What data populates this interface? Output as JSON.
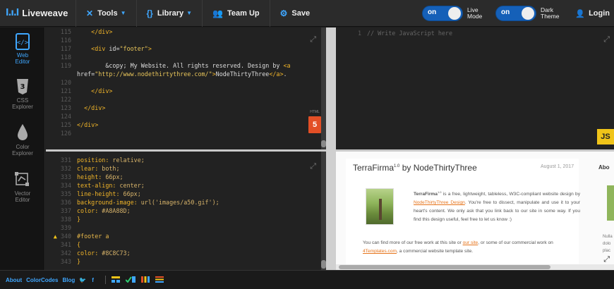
{
  "topbar": {
    "brand_logo": "l.ı.l",
    "brand_name": "Liveweave",
    "tools_label": "Tools",
    "library_label": "Library",
    "teamup_label": "Team Up",
    "save_label": "Save",
    "live_mode": {
      "state": "on",
      "label_line1": "Live",
      "label_line2": "Mode"
    },
    "dark_theme": {
      "state": "on",
      "label_line1": "Dark",
      "label_line2": "Theme"
    },
    "login_label": "Login"
  },
  "sidebar": {
    "web_editor": {
      "line1": "Web",
      "line2": "Editor"
    },
    "css_explorer": {
      "line1": "CSS",
      "line2": "Explorer"
    },
    "color_explorer": {
      "line1": "Color",
      "line2": "Explorer"
    },
    "vector_editor": {
      "line1": "Vector",
      "line2": "Editor"
    }
  },
  "html_editor": {
    "badge_caption": "HTML",
    "badge_text": "5",
    "lines": [
      {
        "n": "115",
        "t": "    </div>"
      },
      {
        "n": "116",
        "t": ""
      },
      {
        "n": "117",
        "t": "    <div id=\"footer\">"
      },
      {
        "n": "118",
        "t": ""
      },
      {
        "n": "119",
        "t": "        &copy; My Website. All rights reserved. Design by <a"
      },
      {
        "n": "",
        "t": "href=\"http://www.nodethirtythree.com/\">NodeThirtyThree</a>."
      },
      {
        "n": "120",
        "t": ""
      },
      {
        "n": "121",
        "t": "    </div>"
      },
      {
        "n": "122",
        "t": ""
      },
      {
        "n": "123",
        "t": "  </div>"
      },
      {
        "n": "124",
        "t": ""
      },
      {
        "n": "125",
        "t": "</div>"
      },
      {
        "n": "126",
        "t": ""
      }
    ]
  },
  "css_editor": {
    "lines": [
      {
        "n": "331",
        "t": "position: relative;"
      },
      {
        "n": "332",
        "t": "clear: both;"
      },
      {
        "n": "333",
        "t": "height: 66px;"
      },
      {
        "n": "334",
        "t": "text-align: center;"
      },
      {
        "n": "335",
        "t": "line-height: 66px;"
      },
      {
        "n": "336",
        "t": "background-image: url('images/a50.gif');"
      },
      {
        "n": "337",
        "t": "color: #A8A88D;"
      },
      {
        "n": "338",
        "t": "}"
      },
      {
        "n": "339",
        "t": ""
      },
      {
        "n": "340",
        "t": "#footer a"
      },
      {
        "n": "341",
        "t": "{"
      },
      {
        "n": "342",
        "t": "color: #8C8C73;"
      },
      {
        "n": "343",
        "t": "}"
      }
    ],
    "warning_line": "340"
  },
  "js_editor": {
    "lines": [
      {
        "n": "1",
        "t": "// Write JavaScript here"
      }
    ],
    "badge_text": "JS"
  },
  "preview": {
    "title": "TerraFirma",
    "title_sup": "1.0",
    "title_suffix": " by NodeThirtyThree",
    "date": "August 1, 2017",
    "para1_strong": "TerraFirma",
    "para1_sup": "1.0",
    "para1_a": " is a free, lightweight, tableless, W3C-compliant website design by ",
    "para1_link": "NodeThirtyThree Design",
    "para1_b": ". You're free to dissect, manipulate and use it to your heart's content. We only ask that you link back to our site in some way. If you find this design useful, feel free to let us know :)",
    "para2_a": "You can find more of our free work at this site or ",
    "para2_link1": "our site",
    "para2_b": ", or some of our commercial work on ",
    "para2_link2": "4Templates.com",
    "para2_c": ", a commercial website template site.",
    "side_heading": "Abo",
    "side_text_1": "Nulla",
    "side_text_2": "dolo",
    "side_text_3": "plac"
  },
  "footer": {
    "about": "About",
    "colorcodes": "ColorCodes",
    "blog": "Blog"
  },
  "colors": {
    "accent": "#3fa7ff",
    "toggle_bg": "#1560b8",
    "html5_badge": "#e34f26",
    "js_badge": "#f0c419"
  }
}
